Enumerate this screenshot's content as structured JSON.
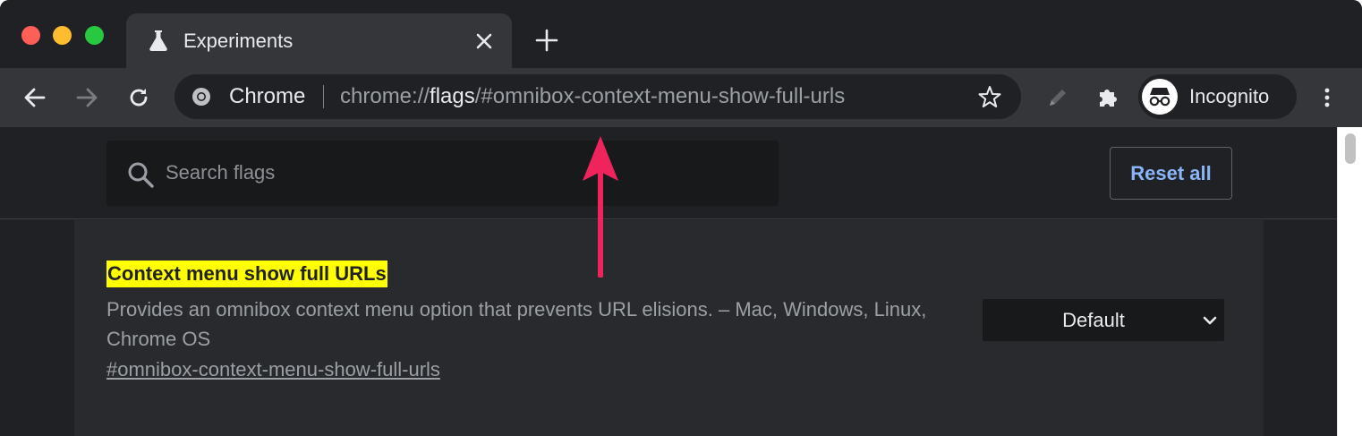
{
  "tab": {
    "title": "Experiments",
    "icon": "flask-icon"
  },
  "toolbar": {
    "omnibox": {
      "chip": "Chrome",
      "url_scheme": "chrome://",
      "url_host": "flags",
      "url_rest": "/#omnibox-context-menu-show-full-urls"
    },
    "profile": {
      "label": "Incognito",
      "icon": "incognito-icon"
    }
  },
  "page": {
    "search": {
      "placeholder": "Search flags",
      "value": ""
    },
    "reset_label": "Reset all",
    "experiment": {
      "title": "Context menu show full URLs",
      "description": "Provides an omnibox context menu option that prevents URL elisions. – Mac, Windows, Linux, Chrome OS",
      "link": "#omnibox-context-menu-show-full-urls",
      "selected_option": "Default"
    }
  },
  "colors": {
    "highlight": "#ffff00",
    "accent": "#8ab4f8",
    "annotation_arrow": "#f0245d",
    "background": "#202124"
  }
}
